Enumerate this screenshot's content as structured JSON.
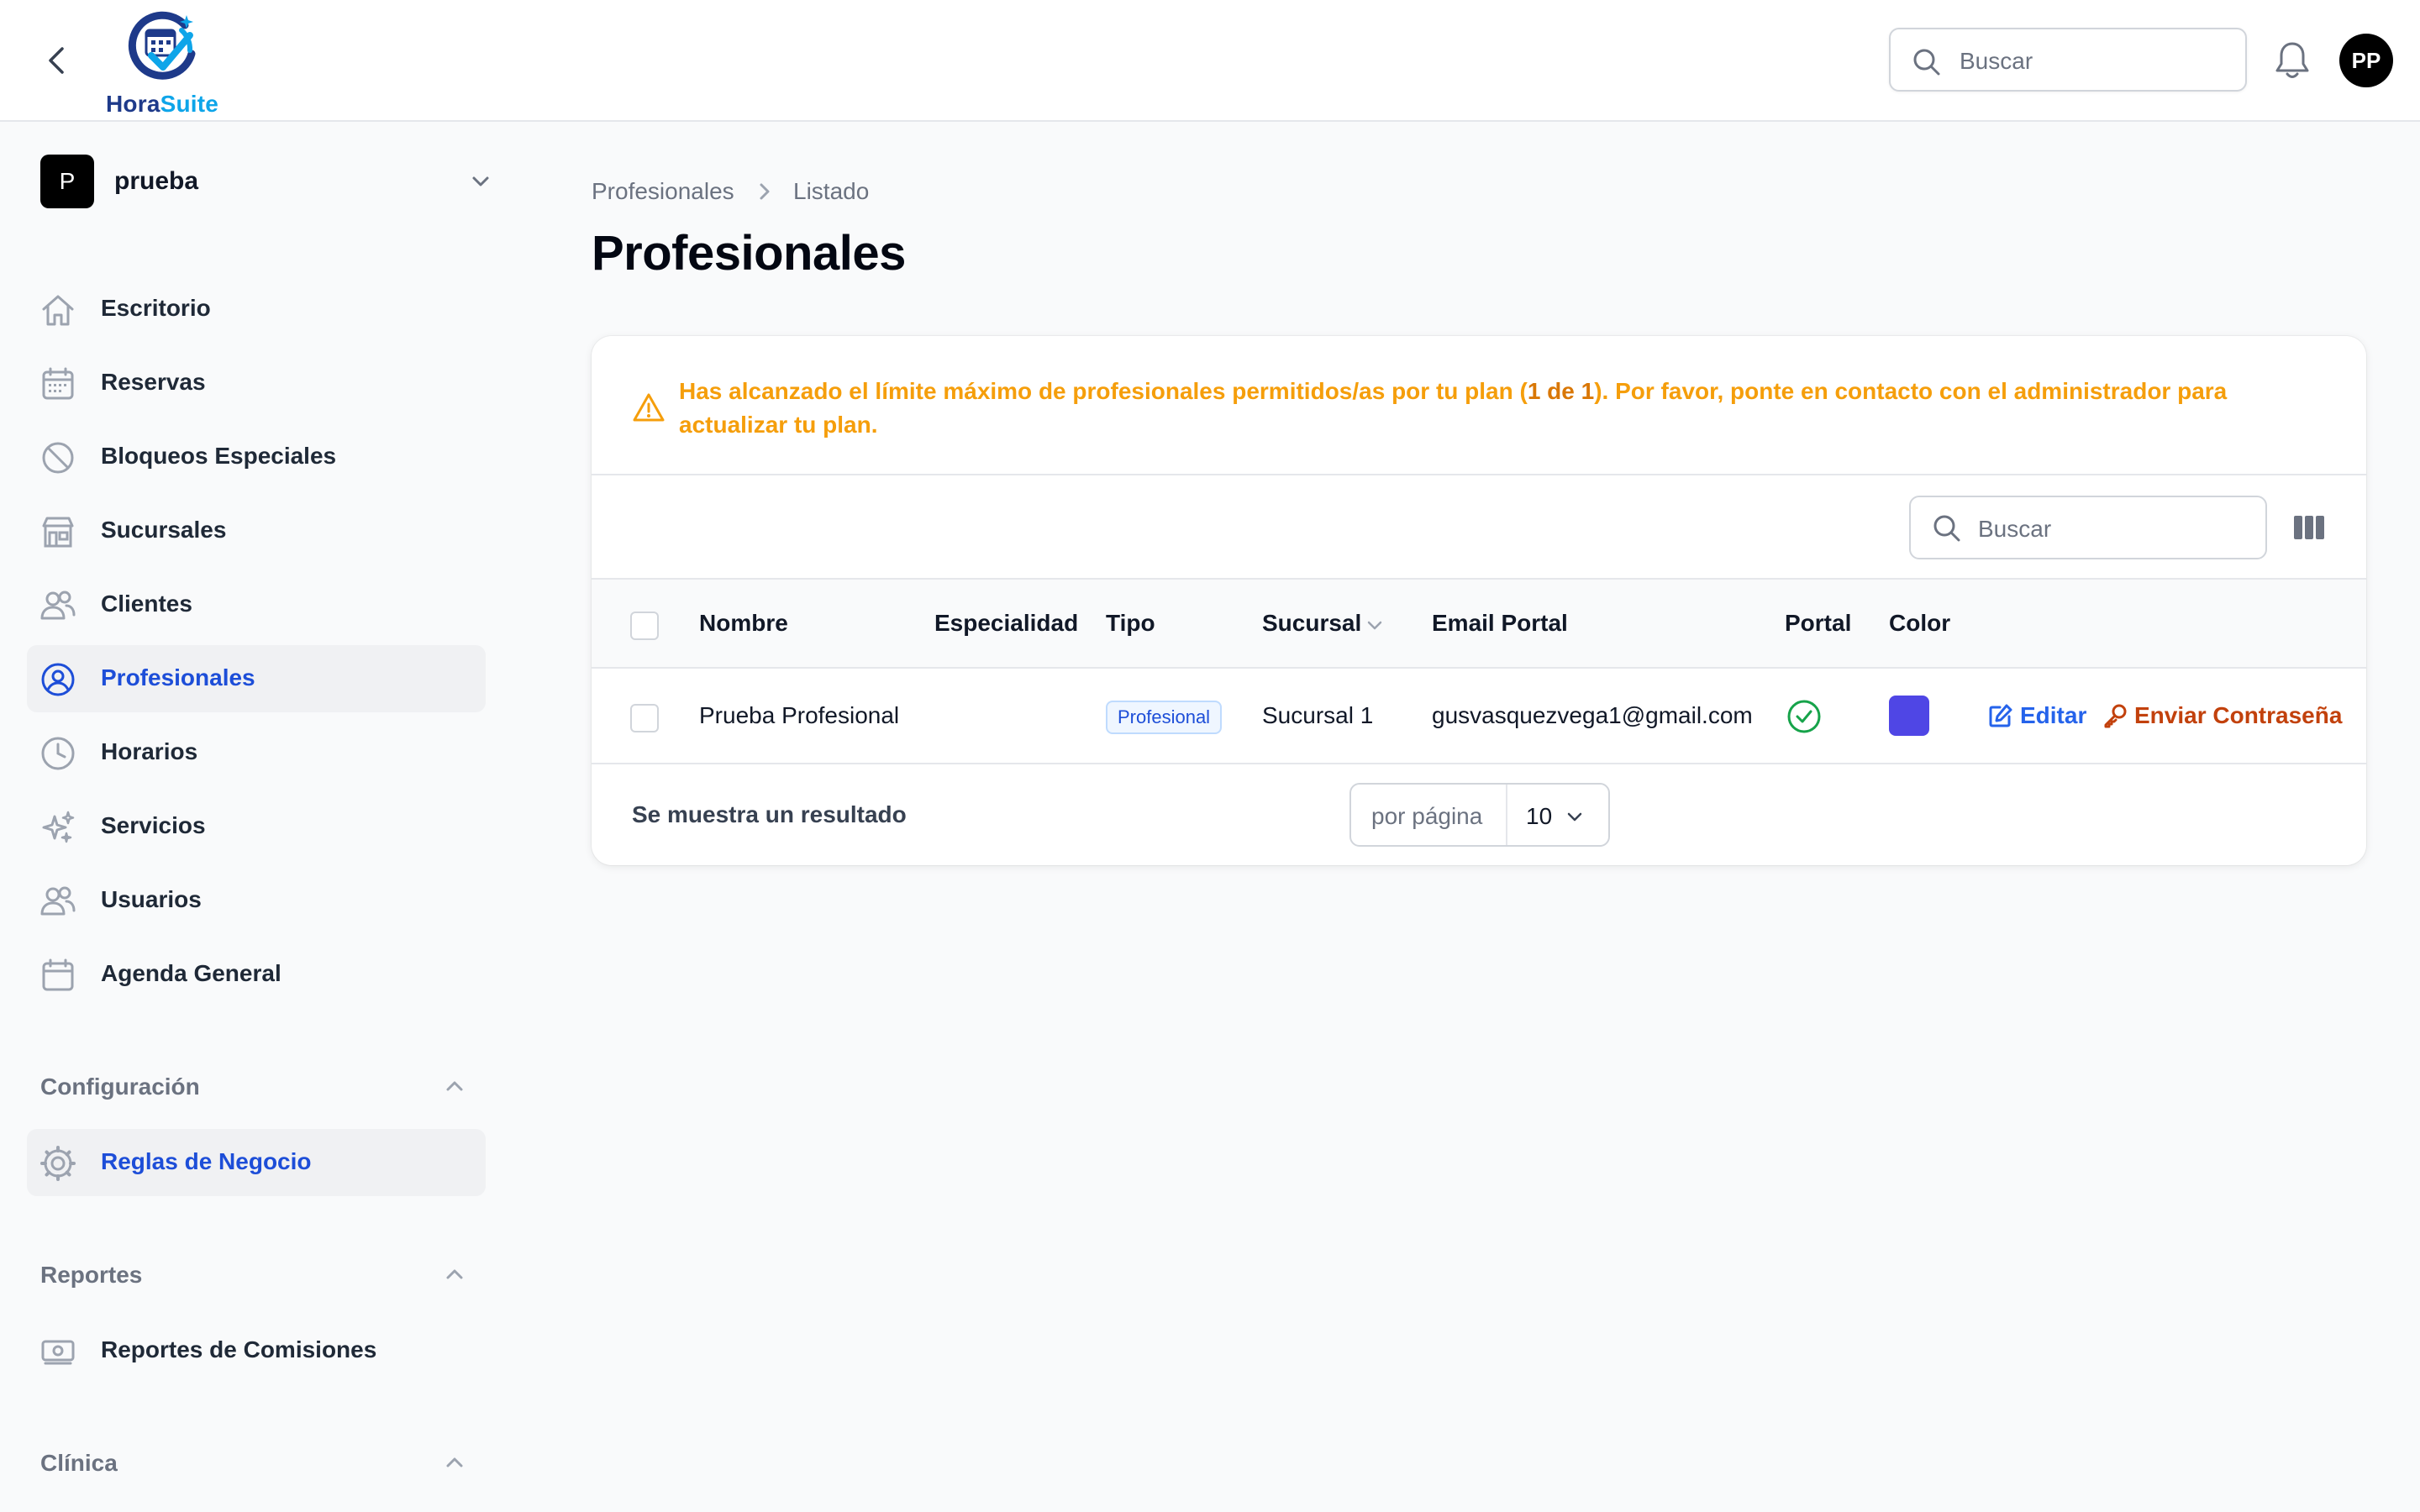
{
  "brand": {
    "name_part1": "Hora",
    "name_part2": "Suite"
  },
  "topbar": {
    "search_placeholder": "Buscar",
    "user_initials": "PP"
  },
  "tenant": {
    "badge": "P",
    "name": "prueba"
  },
  "sidebar": {
    "items": [
      {
        "label": "Escritorio",
        "icon": "home-icon"
      },
      {
        "label": "Reservas",
        "icon": "calendar-grid-icon"
      },
      {
        "label": "Bloqueos Especiales",
        "icon": "ban-icon"
      },
      {
        "label": "Sucursales",
        "icon": "storefront-icon"
      },
      {
        "label": "Clientes",
        "icon": "users-icon"
      },
      {
        "label": "Profesionales",
        "icon": "user-circle-icon",
        "active": true
      },
      {
        "label": "Horarios",
        "icon": "clock-icon"
      },
      {
        "label": "Servicios",
        "icon": "sparkles-icon"
      },
      {
        "label": "Usuarios",
        "icon": "users-icon"
      },
      {
        "label": "Agenda General",
        "icon": "calendar-icon"
      }
    ],
    "groups": {
      "config": {
        "label": "Configuración",
        "items": [
          {
            "label": "Reglas de Negocio",
            "icon": "cog-icon"
          }
        ]
      },
      "reports": {
        "label": "Reportes",
        "items": [
          {
            "label": "Reportes de Comisiones",
            "icon": "banknotes-icon"
          }
        ]
      },
      "clinic": {
        "label": "Clínica"
      }
    }
  },
  "breadcrumb": {
    "parent": "Profesionales",
    "current": "Listado"
  },
  "page": {
    "title": "Profesionales"
  },
  "alert": {
    "text_before": "Has alcanzado el límite máximo de profesionales permitidos/as por tu plan (",
    "highlight": "1 de 1",
    "text_after": "). Por favor, ponte en contacto con el administrador para actualizar tu plan.",
    "color": "#f59e0b"
  },
  "table": {
    "search_placeholder": "Buscar",
    "columns": [
      "Nombre",
      "Especialidad",
      "Tipo",
      "Sucursal",
      "Email Portal",
      "Portal",
      "Color"
    ],
    "rows": [
      {
        "nombre": "Prueba Profesional",
        "especialidad": "",
        "tipo": "Profesional",
        "sucursal": "Sucursal 1",
        "email": "gusvasquezvega1@gmail.com",
        "portal": true,
        "color": "#4f46e5",
        "actions": {
          "edit": "Editar",
          "send_password": "Enviar Contraseña"
        }
      }
    ],
    "footer": {
      "result_text": "Se muestra un resultado",
      "per_page_label": "por página",
      "per_page_value": "10"
    }
  }
}
